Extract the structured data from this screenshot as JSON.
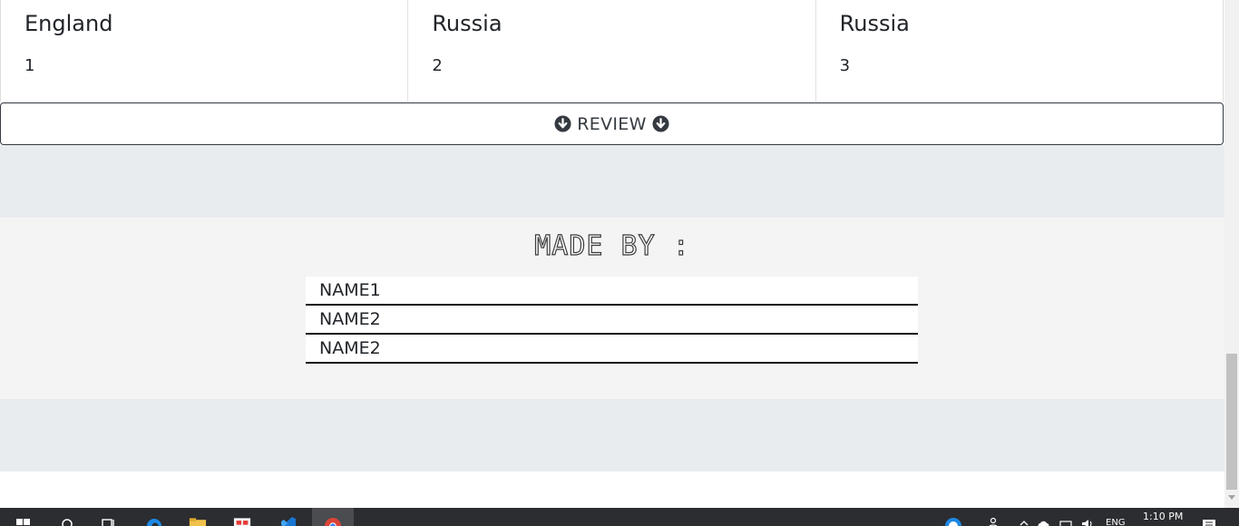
{
  "cards": [
    {
      "title": "England",
      "value": "1"
    },
    {
      "title": "Russia",
      "value": "2"
    },
    {
      "title": "Russia",
      "value": "3"
    }
  ],
  "review_button": {
    "label": "REVIEW"
  },
  "credits": {
    "title": "MADE BY :",
    "names": [
      "NAME1",
      "NAME2",
      "NAME2"
    ]
  },
  "taskbar": {
    "time": "1:10 PM",
    "language": "ENG",
    "icons": [
      "windows-start-icon",
      "search-icon",
      "task-view-icon",
      "edge-icon",
      "file-explorer-icon",
      "store-icon",
      "vscode-icon",
      "chrome-icon"
    ]
  },
  "colors": {
    "grey_band": "#e9ecef",
    "credits_bg": "#f4f4f4",
    "taskbar": "#2b2d31",
    "text": "#212529"
  }
}
